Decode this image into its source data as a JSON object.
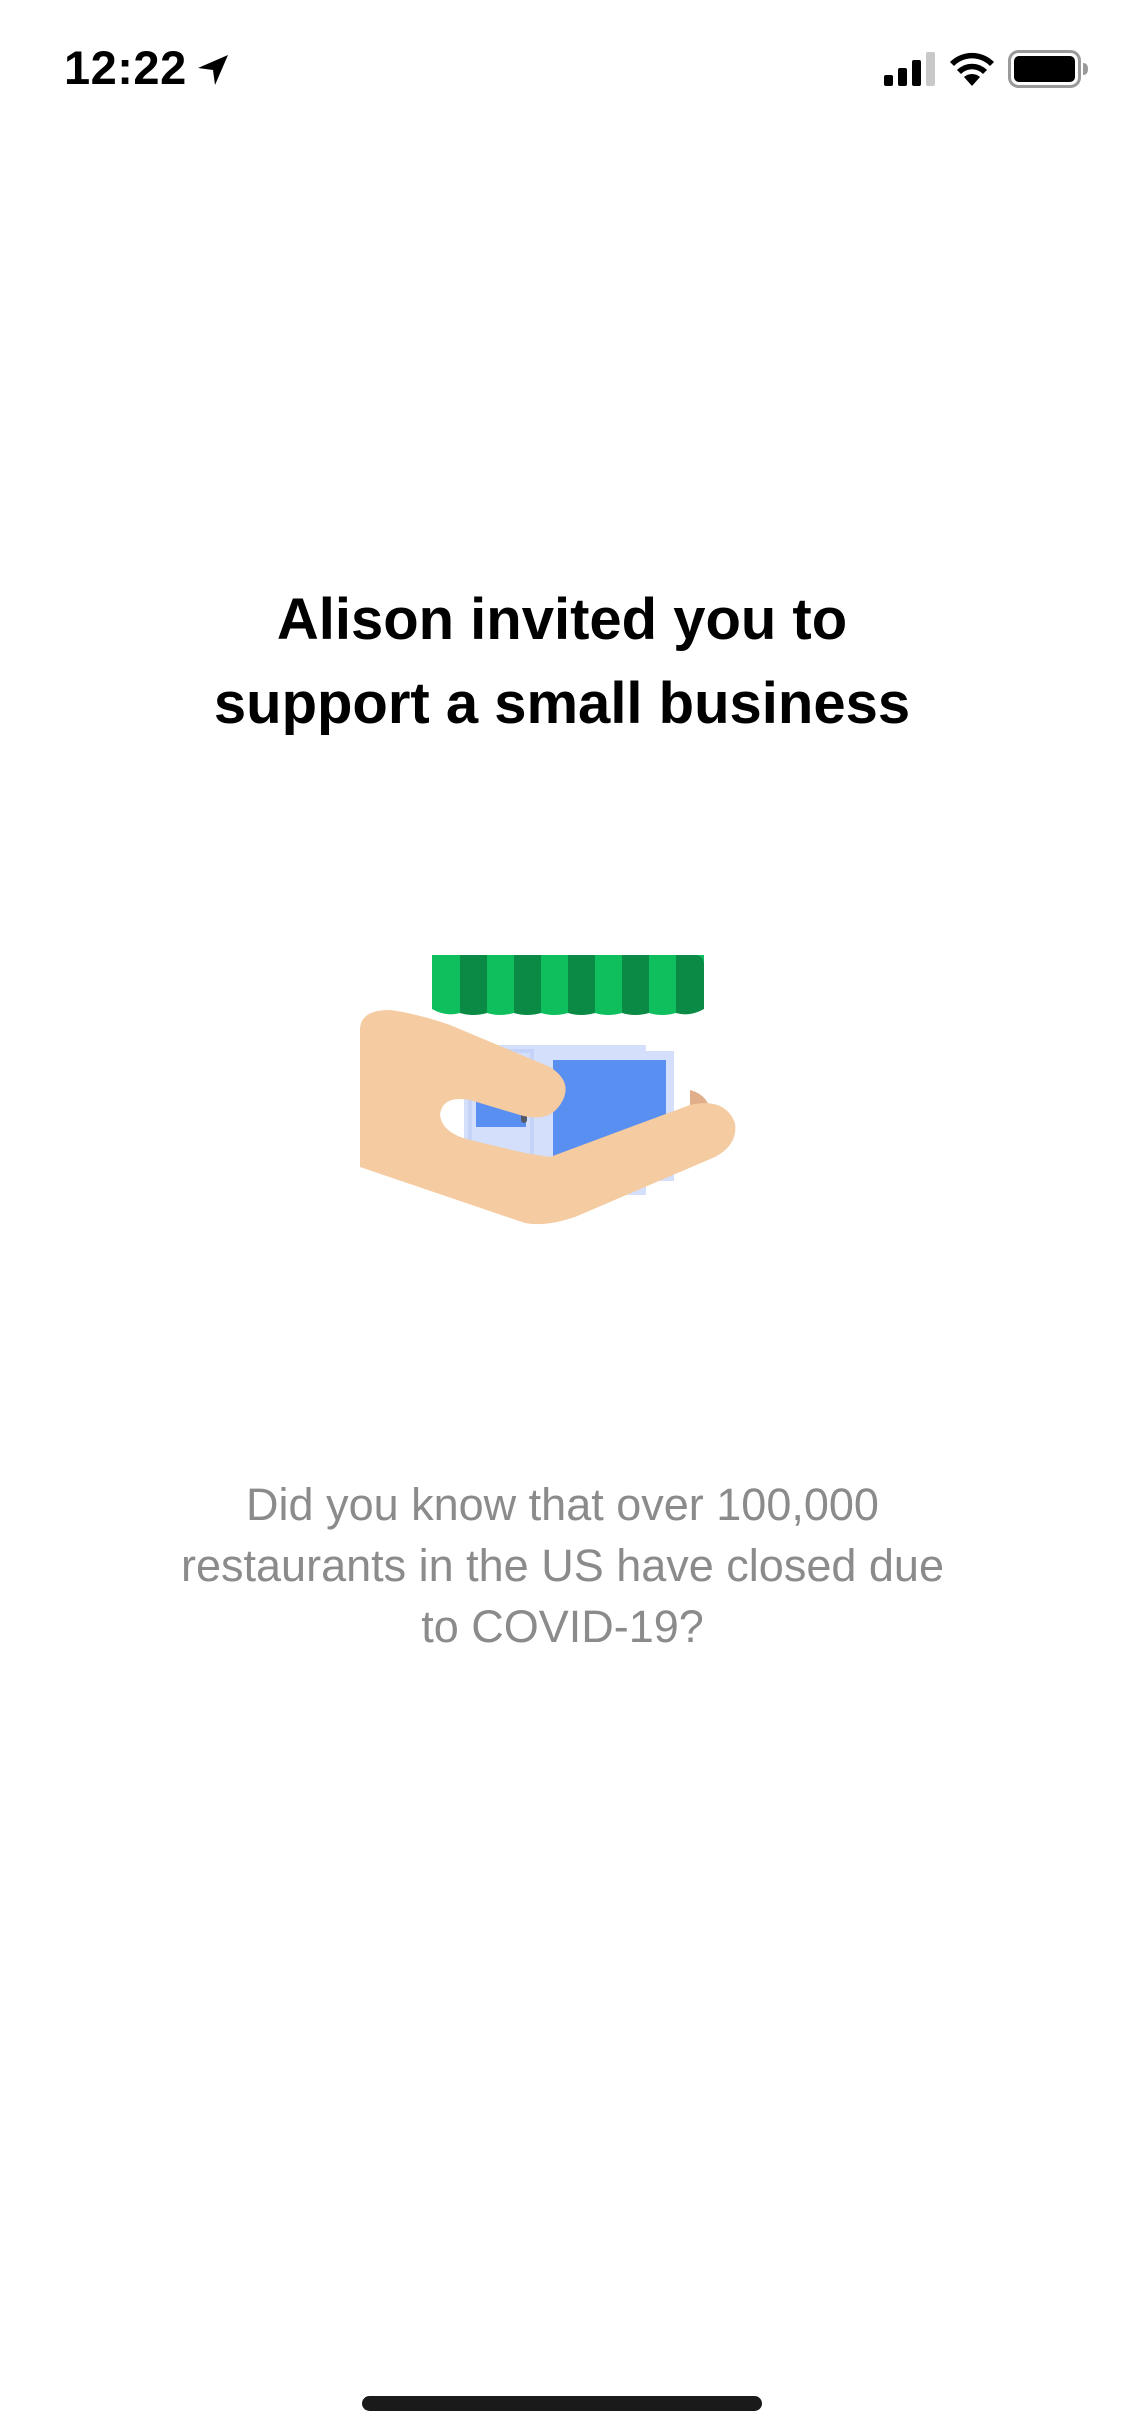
{
  "status_bar": {
    "time": "12:22",
    "icons": [
      "location-arrow-icon",
      "cellular-signal-icon",
      "wifi-icon",
      "battery-icon"
    ]
  },
  "invite": {
    "headline_line1": "Alison invited you to",
    "headline_line2": "support a small business",
    "illustration": "hand-holding-storefront-icon",
    "fact_line1": "Did you know that over 100,000",
    "fact_line2": "restaurants in the US have closed due",
    "fact_line3": "to COVID-19?"
  },
  "colors": {
    "awning_light": "#0fbf5e",
    "awning_dark": "#0a8a45",
    "window_blue": "#5a8ff2",
    "store_pale": "#d3dffb",
    "hand_skin": "#f5cba1",
    "thumb_shadow": "#e0ae89",
    "fact_text": "#8b8b8b"
  }
}
